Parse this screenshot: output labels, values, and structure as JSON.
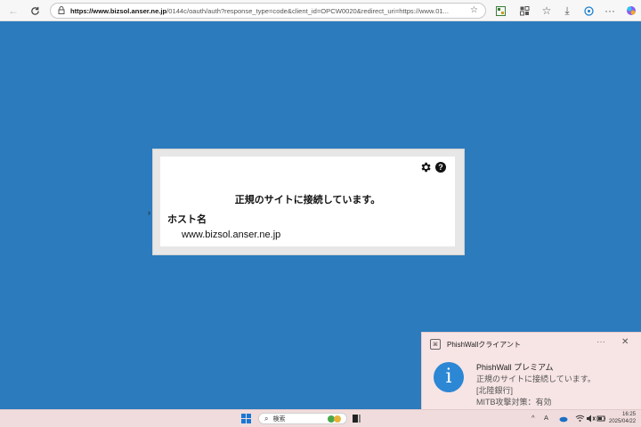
{
  "browser": {
    "url_host": "https://www.bizsol.anser.ne.jp",
    "url_rest": "/0144c/oauth/auth?response_type=code&client_id=OPCW0020&redirect_uri=https://www.01..."
  },
  "dialog": {
    "title": "正規のサイトに接続しています。",
    "host_label": "ホスト名",
    "host_value": "www.bizsol.anser.ne.jp",
    "help_glyph": "?"
  },
  "notification": {
    "app_name": "PhishWallクライアント",
    "more": "···",
    "close": "✕",
    "title": "PhishWall プレミアム",
    "line1": "正規のサイトに接続しています。",
    "line2": "[北陸銀行]",
    "line3": "MITB攻撃対策：有効",
    "info_glyph": "i"
  },
  "taskbar": {
    "search_placeholder": "検索",
    "ime": "A",
    "time": "16:25",
    "date": "2025/04/22"
  },
  "colors": {
    "page_background": "#2b7bbd",
    "info_icon": "#2c87d4",
    "toast_background": "#f7e4e4"
  }
}
